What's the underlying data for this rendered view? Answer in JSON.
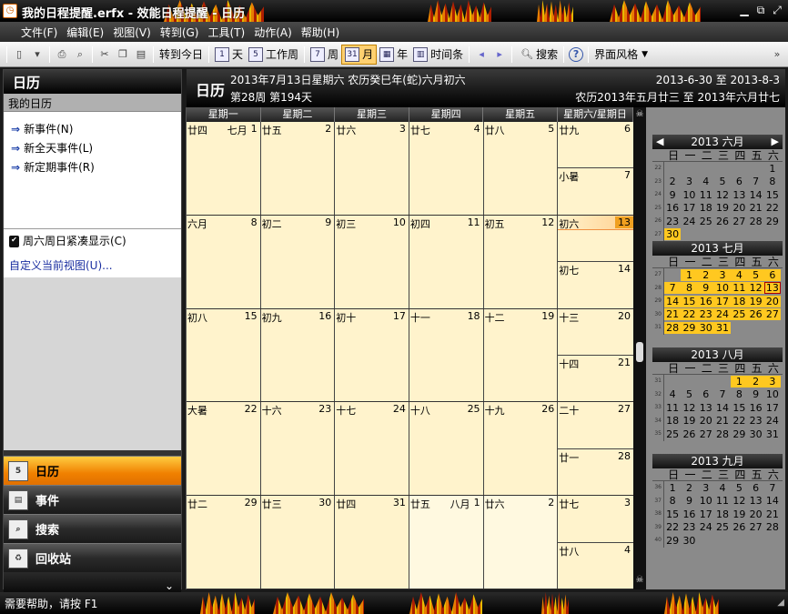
{
  "window": {
    "title": "我的日程提醒.erfx - 效能日程提醒 - 日历"
  },
  "menu": [
    "文件(F)",
    "编辑(E)",
    "视图(V)",
    "转到(G)",
    "工具(T)",
    "动作(A)",
    "帮助(H)"
  ],
  "toolbar": {
    "goto_today": "转到今日",
    "day": "天",
    "work_week": "工作周",
    "week": "周",
    "month": "月",
    "year": "年",
    "timeline": "时间条",
    "search": "搜索",
    "theme": "界面风格"
  },
  "left": {
    "title": "日历",
    "subtitle": "我的日历",
    "actions": [
      "新事件(N)",
      "新全天事件(L)",
      "新定期事件(R)"
    ],
    "compact_weekend": "周六周日紧凑显示(C)",
    "customize_view": "自定义当前视图(U)...",
    "nav": [
      "日历",
      "事件",
      "搜索",
      "回收站"
    ]
  },
  "header": {
    "title": "日历",
    "date_line": "2013年7月13日星期六  农历癸巳年(蛇)六月初六",
    "week_line": "第28周  第194天",
    "range": "2013-6-30 至 2013-8-3",
    "lunar_range": "农历2013年五月廿三 至 2013年六月廿七"
  },
  "grid": {
    "weekdays": [
      "星期一",
      "星期二",
      "星期三",
      "星期四",
      "星期五",
      "星期六/星期日"
    ],
    "weeks": [
      {
        "days": [
          {
            "lunar": "廿四",
            "month": "七月",
            "num": "1"
          },
          {
            "lunar": "廿五",
            "num": "2"
          },
          {
            "lunar": "廿六",
            "num": "3"
          },
          {
            "lunar": "廿七",
            "num": "4"
          },
          {
            "lunar": "廿八",
            "num": "5"
          }
        ],
        "sat": {
          "lunar": "廿九",
          "num": "6"
        },
        "sun": {
          "lunar": "小暑",
          "num": "7"
        }
      },
      {
        "days": [
          {
            "lunar": "六月",
            "num": "8"
          },
          {
            "lunar": "初二",
            "num": "9"
          },
          {
            "lunar": "初三",
            "num": "10"
          },
          {
            "lunar": "初四",
            "num": "11"
          },
          {
            "lunar": "初五",
            "num": "12"
          }
        ],
        "sat": {
          "lunar": "初六",
          "num": "13",
          "today": true
        },
        "sun": {
          "lunar": "初七",
          "num": "14"
        }
      },
      {
        "days": [
          {
            "lunar": "初八",
            "num": "15"
          },
          {
            "lunar": "初九",
            "num": "16"
          },
          {
            "lunar": "初十",
            "num": "17"
          },
          {
            "lunar": "十一",
            "num": "18"
          },
          {
            "lunar": "十二",
            "num": "19"
          }
        ],
        "sat": {
          "lunar": "十三",
          "num": "20"
        },
        "sun": {
          "lunar": "十四",
          "num": "21"
        }
      },
      {
        "days": [
          {
            "lunar": "大暑",
            "num": "22"
          },
          {
            "lunar": "十六",
            "num": "23"
          },
          {
            "lunar": "十七",
            "num": "24"
          },
          {
            "lunar": "十八",
            "num": "25"
          },
          {
            "lunar": "十九",
            "num": "26"
          }
        ],
        "sat": {
          "lunar": "二十",
          "num": "27"
        },
        "sun": {
          "lunar": "廿一",
          "num": "28"
        }
      },
      {
        "days": [
          {
            "lunar": "廿二",
            "num": "29"
          },
          {
            "lunar": "廿三",
            "num": "30"
          },
          {
            "lunar": "廿四",
            "num": "31"
          },
          {
            "lunar": "廿五",
            "month": "八月",
            "num": "1",
            "other": true
          },
          {
            "lunar": "廿六",
            "num": "2",
            "other": true
          }
        ],
        "sat": {
          "lunar": "廿七",
          "num": "3",
          "other": true
        },
        "sun": {
          "lunar": "廿八",
          "num": "4",
          "other": true
        }
      }
    ]
  },
  "mini_calendars": {
    "dow": [
      "日",
      "一",
      "二",
      "三",
      "四",
      "五",
      "六"
    ],
    "months": [
      {
        "title": "2013 六月",
        "nav": true,
        "weeks": [
          {
            "wn": "22",
            "days": [
              "",
              "",
              "",
              "",
              "",
              "",
              "1"
            ]
          },
          {
            "wn": "23",
            "days": [
              "2",
              "3",
              "4",
              "5",
              "6",
              "7",
              "8"
            ]
          },
          {
            "wn": "24",
            "days": [
              "9",
              "10",
              "11",
              "12",
              "13",
              "14",
              "15"
            ]
          },
          {
            "wn": "25",
            "days": [
              "16",
              "17",
              "18",
              "19",
              "20",
              "21",
              "22"
            ]
          },
          {
            "wn": "26",
            "days": [
              "23",
              "24",
              "25",
              "26",
              "27",
              "28",
              "29"
            ]
          },
          {
            "wn": "27",
            "days": [
              "30",
              "",
              "",
              "",
              "",
              "",
              ""
            ],
            "hl": [
              0
            ]
          }
        ]
      },
      {
        "title": "2013 七月",
        "weeks": [
          {
            "wn": "27",
            "days": [
              "",
              "1",
              "2",
              "3",
              "4",
              "5",
              "6"
            ],
            "hl": [
              1,
              2,
              3,
              4,
              5,
              6
            ]
          },
          {
            "wn": "28",
            "days": [
              "7",
              "8",
              "9",
              "10",
              "11",
              "12",
              "13"
            ],
            "hl": [
              0,
              1,
              2,
              3,
              4,
              5
            ],
            "sel": [
              6
            ]
          },
          {
            "wn": "29",
            "days": [
              "14",
              "15",
              "16",
              "17",
              "18",
              "19",
              "20"
            ],
            "hl": [
              0,
              1,
              2,
              3,
              4,
              5,
              6
            ]
          },
          {
            "wn": "30",
            "days": [
              "21",
              "22",
              "23",
              "24",
              "25",
              "26",
              "27"
            ],
            "hl": [
              0,
              1,
              2,
              3,
              4,
              5,
              6
            ]
          },
          {
            "wn": "31",
            "days": [
              "28",
              "29",
              "30",
              "31",
              "",
              "",
              ""
            ],
            "hl": [
              0,
              1,
              2,
              3
            ]
          }
        ]
      },
      {
        "title": "2013 八月",
        "weeks": [
          {
            "wn": "31",
            "days": [
              "",
              "",
              "",
              "",
              "1",
              "2",
              "3"
            ],
            "hl": [
              4,
              5,
              6
            ]
          },
          {
            "wn": "32",
            "days": [
              "4",
              "5",
              "6",
              "7",
              "8",
              "9",
              "10"
            ]
          },
          {
            "wn": "33",
            "days": [
              "11",
              "12",
              "13",
              "14",
              "15",
              "16",
              "17"
            ]
          },
          {
            "wn": "34",
            "days": [
              "18",
              "19",
              "20",
              "21",
              "22",
              "23",
              "24"
            ]
          },
          {
            "wn": "35",
            "days": [
              "25",
              "26",
              "27",
              "28",
              "29",
              "30",
              "31"
            ]
          }
        ]
      },
      {
        "title": "2013 九月",
        "weeks": [
          {
            "wn": "36",
            "days": [
              "1",
              "2",
              "3",
              "4",
              "5",
              "6",
              "7"
            ]
          },
          {
            "wn": "37",
            "days": [
              "8",
              "9",
              "10",
              "11",
              "12",
              "13",
              "14"
            ]
          },
          {
            "wn": "38",
            "days": [
              "15",
              "16",
              "17",
              "18",
              "19",
              "20",
              "21"
            ]
          },
          {
            "wn": "39",
            "days": [
              "22",
              "23",
              "24",
              "25",
              "26",
              "27",
              "28"
            ]
          },
          {
            "wn": "40",
            "days": [
              "29",
              "30",
              "",
              "",
              "",
              "",
              ""
            ]
          }
        ]
      }
    ]
  },
  "status": {
    "text": "需要帮助，请按 F1"
  }
}
